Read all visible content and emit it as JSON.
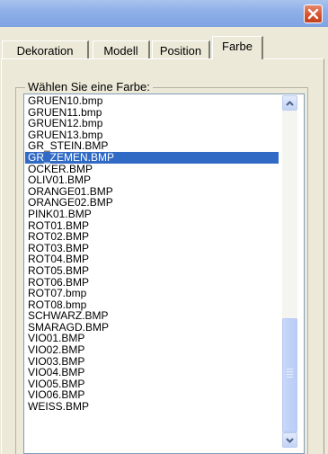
{
  "tabs": [
    {
      "label": "Dekoration"
    },
    {
      "label": "Modell"
    },
    {
      "label": "Position"
    },
    {
      "label": "Farbe"
    }
  ],
  "active_tab": "Farbe",
  "group": {
    "label": "Wählen Sie eine Farbe:"
  },
  "list": {
    "items": [
      "GRUEN10.bmp",
      "GRUEN11.bmp",
      "GRUEN12.bmp",
      "GRUEN13.bmp",
      "GR_STEIN.BMP",
      "GR_ZEMEN.BMP",
      "OCKER.BMP",
      "OLIV01.BMP",
      "ORANGE01.BMP",
      "ORANGE02.BMP",
      "PINK01.BMP",
      "ROT01.BMP",
      "ROT02.BMP",
      "ROT03.BMP",
      "ROT04.BMP",
      "ROT05.BMP",
      "ROT06.BMP",
      "ROT07.bmp",
      "ROT08.bmp",
      "SCHWARZ.BMP",
      "SMARAGD.BMP",
      "VIO01.BMP",
      "VIO02.BMP",
      "VIO03.BMP",
      "VIO04.BMP",
      "VIO05.BMP",
      "VIO06.BMP",
      "WEISS.BMP"
    ],
    "selected_index": 5
  },
  "icons": {
    "close": "close-icon",
    "scroll_up": "chevron-up-icon",
    "scroll_down": "chevron-down-icon"
  },
  "colors": {
    "selection": "#316ac5",
    "close_button": "#d8532f",
    "titlebar": "#8fb0e8",
    "dialog_bg": "#ece9d8"
  }
}
